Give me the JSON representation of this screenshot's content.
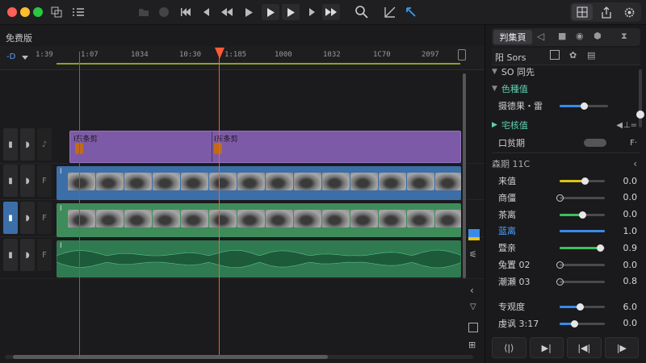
{
  "window": {
    "traffic_lights": [
      "#ff5f57",
      "#febc2e",
      "#28c840"
    ]
  },
  "toolbar": {
    "playback_icons": [
      "skip-back-icon",
      "step-back-icon",
      "rewind-icon",
      "play-icon",
      "play-box-icon",
      "play-next-box-icon",
      "step-forward-icon",
      "fast-forward-icon"
    ]
  },
  "timeline": {
    "title": "免费版",
    "timecode_prefix": "-D",
    "ruler_labels": [
      "1:39",
      "1:07",
      "1034",
      "10:30",
      "1:185",
      "1000",
      "1032",
      "1C70",
      "2097"
    ],
    "tracks": [
      {
        "type": "title",
        "clips": [
          "I东条剪",
          "I东条剪"
        ]
      },
      {
        "type": "video",
        "label": "I"
      },
      {
        "type": "video",
        "label": "I"
      },
      {
        "type": "audio",
        "label": "I"
      }
    ]
  },
  "inspector": {
    "tab_title": "判集頁",
    "subbar_label": "阳 Sors",
    "sections": {
      "top": "SO 同先",
      "color": "色種值",
      "color_sub": "摄德果・雷",
      "effect": "宅核值",
      "effect_sub": "口贫期",
      "params_title": "森期 11C"
    },
    "params": [
      {
        "label": "来值",
        "value": "0.0",
        "color": "#d8c21c",
        "fill": 0.55,
        "knob": 0.55
      },
      {
        "label": "商僵",
        "value": "0.0",
        "color": "#c94a78",
        "fill": 0.0,
        "knob": 0.0
      },
      {
        "label": "茶离",
        "value": "0.0",
        "color": "#3cc05c",
        "fill": 0.5,
        "knob": 0.5
      },
      {
        "label": "蓝离",
        "value": "1.0",
        "color": "#3a8ae8",
        "fill": 1.0,
        "knob": null
      },
      {
        "label": "暨亲",
        "value": "0.9",
        "color": "#3cc05c",
        "fill": 0.9,
        "knob": 0.9
      },
      {
        "label": "兔置 02",
        "value": "0.0",
        "color": "#c94a78",
        "fill": 0.0,
        "knob": 0.0
      },
      {
        "label": "潮瀬 03",
        "value": "0.8",
        "color": "#c94a78",
        "fill": 0.0,
        "knob": 0.0
      }
    ],
    "bottom_params": [
      {
        "label": "专观度",
        "value": "6.0",
        "color": "#3a8ae8",
        "fill": 0.45,
        "knob": 0.45
      },
      {
        "label": "虔讽 3:17",
        "value": "0.0",
        "color": "#3a8ae8",
        "fill": 0.32,
        "knob": 0.32
      }
    ],
    "bottom_buttons": [
      "⟨|⟩",
      "▶|",
      "|◀|",
      "|▶"
    ]
  }
}
